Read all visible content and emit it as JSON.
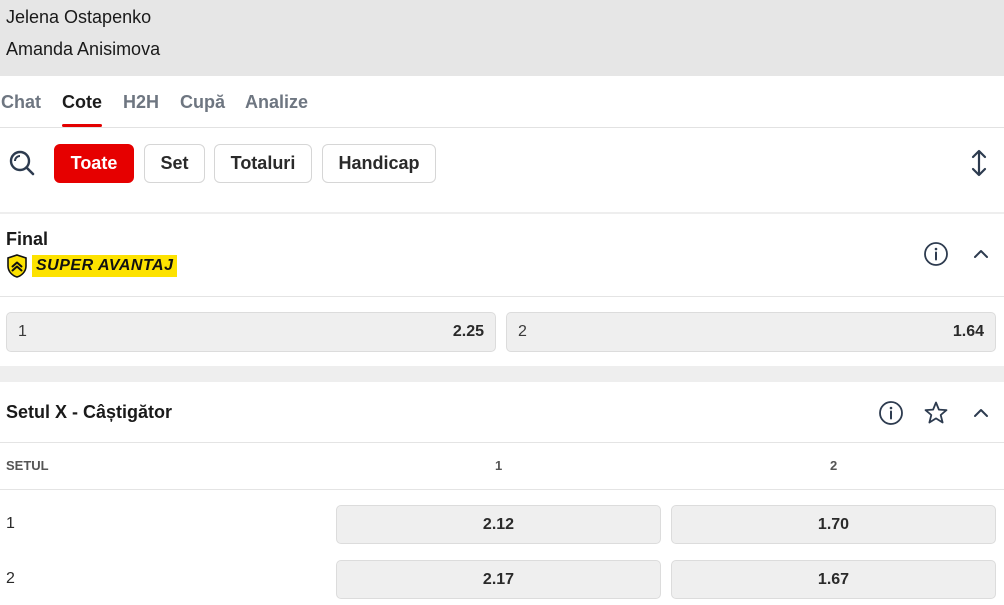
{
  "match": {
    "player1": "Jelena Ostapenko",
    "player2": "Amanda Anisimova"
  },
  "tabs": [
    {
      "label": "Chat",
      "active": false
    },
    {
      "label": "Cote",
      "active": true
    },
    {
      "label": "H2H",
      "active": false
    },
    {
      "label": "Cupă",
      "active": false
    },
    {
      "label": "Analize",
      "active": false
    }
  ],
  "filters": {
    "search_icon": "search-icon",
    "chips": [
      {
        "label": "Toate",
        "active": true
      },
      {
        "label": "Set",
        "active": false
      },
      {
        "label": "Totaluri",
        "active": false
      },
      {
        "label": "Handicap",
        "active": false
      }
    ],
    "expand_icon": "expand-collapse-icon"
  },
  "markets": {
    "final": {
      "title": "Final",
      "badge": "SUPER AVANTAJ",
      "odds": [
        {
          "label": "1",
          "value": "2.25"
        },
        {
          "label": "2",
          "value": "1.64"
        }
      ]
    },
    "set_winner": {
      "title": "Setul X - Câștigător",
      "columns": [
        "SETUL",
        "1",
        "2"
      ],
      "rows": [
        {
          "set": "1",
          "odd1": "2.12",
          "odd2": "1.70"
        },
        {
          "set": "2",
          "odd1": "2.17",
          "odd2": "1.67"
        }
      ]
    }
  },
  "colors": {
    "accent": "#e60000",
    "badge_yellow": "#fde200",
    "header_gray": "#e6e6e6",
    "odd_bg": "#efefef"
  }
}
